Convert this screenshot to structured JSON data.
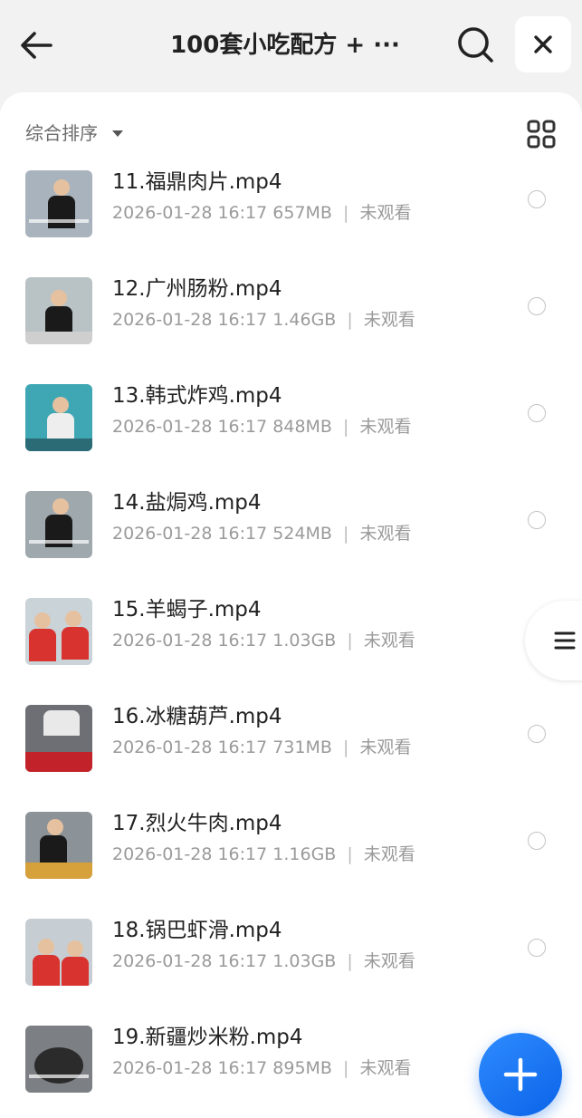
{
  "header": {
    "title": "100套小吃配方 + ···"
  },
  "toolbar": {
    "sort_label": "综合排序"
  },
  "files": [
    {
      "name": "11.福鼎肉片.mp4",
      "date": "2026-01-28 16:17",
      "size": "657MB",
      "status": "未观看"
    },
    {
      "name": "12.广州肠粉.mp4",
      "date": "2026-01-28 16:17",
      "size": "1.46GB",
      "status": "未观看"
    },
    {
      "name": "13.韩式炸鸡.mp4",
      "date": "2026-01-28 16:17",
      "size": "848MB",
      "status": "未观看"
    },
    {
      "name": "14.盐焗鸡.mp4",
      "date": "2026-01-28 16:17",
      "size": "524MB",
      "status": "未观看"
    },
    {
      "name": "15.羊蝎子.mp4",
      "date": "2026-01-28 16:17",
      "size": "1.03GB",
      "status": "未观看"
    },
    {
      "name": "16.冰糖葫芦.mp4",
      "date": "2026-01-28 16:17",
      "size": "731MB",
      "status": "未观看"
    },
    {
      "name": "17.烈火牛肉.mp4",
      "date": "2026-01-28 16:17",
      "size": "1.16GB",
      "status": "未观看"
    },
    {
      "name": "18.锅巴虾滑.mp4",
      "date": "2026-01-28 16:17",
      "size": "1.03GB",
      "status": "未观看"
    },
    {
      "name": "19.新疆炒米粉.mp4",
      "date": "2026-01-28 16:17",
      "size": "895MB",
      "status": "未观看"
    }
  ],
  "icons": {
    "back": "arrow-left-icon",
    "search": "search-icon",
    "close": "close-icon",
    "grid": "grid-view-icon",
    "menu": "menu-icon",
    "add": "plus-icon"
  },
  "colors": {
    "accent": "#1677ff",
    "background": "#f2f2f2",
    "text_primary": "#222222",
    "text_secondary": "#9a9a9a"
  }
}
